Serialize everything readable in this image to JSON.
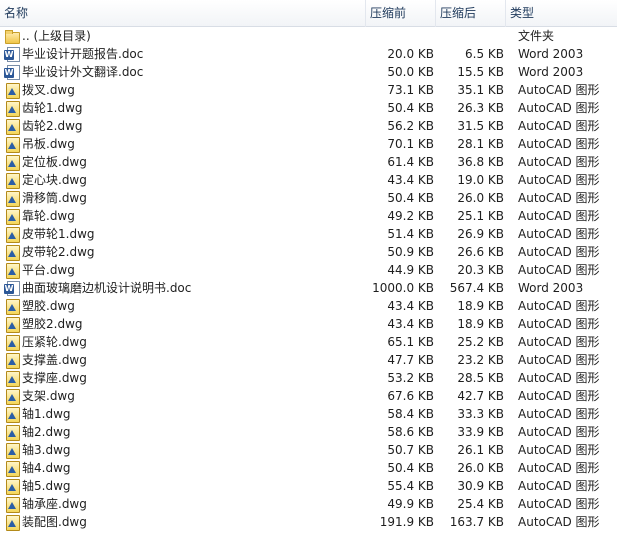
{
  "columns": {
    "name": "名称",
    "original_size": "压缩前",
    "compressed_size": "压缩后",
    "type": "类型"
  },
  "files": [
    {
      "icon": "folder-icon",
      "name": ".. (上级目录)",
      "original": "",
      "compressed": "",
      "type": "文件夹"
    },
    {
      "icon": "word-doc-icon",
      "name": "毕业设计开题报告.doc",
      "original": "20.0 KB",
      "compressed": "6.5 KB",
      "type": "Word 2003"
    },
    {
      "icon": "word-doc-icon",
      "name": "毕业设计外文翻译.doc",
      "original": "50.0 KB",
      "compressed": "15.5 KB",
      "type": "Word 2003"
    },
    {
      "icon": "autocad-dwg-icon",
      "name": "拨叉.dwg",
      "original": "73.1 KB",
      "compressed": "35.1 KB",
      "type": "AutoCAD 图形"
    },
    {
      "icon": "autocad-dwg-icon",
      "name": "齿轮1.dwg",
      "original": "50.4 KB",
      "compressed": "26.3 KB",
      "type": "AutoCAD 图形"
    },
    {
      "icon": "autocad-dwg-icon",
      "name": "齿轮2.dwg",
      "original": "56.2 KB",
      "compressed": "31.5 KB",
      "type": "AutoCAD 图形"
    },
    {
      "icon": "autocad-dwg-icon",
      "name": "吊板.dwg",
      "original": "70.1 KB",
      "compressed": "28.1 KB",
      "type": "AutoCAD 图形"
    },
    {
      "icon": "autocad-dwg-icon",
      "name": "定位板.dwg",
      "original": "61.4 KB",
      "compressed": "36.8 KB",
      "type": "AutoCAD 图形"
    },
    {
      "icon": "autocad-dwg-icon",
      "name": "定心块.dwg",
      "original": "43.4 KB",
      "compressed": "19.0 KB",
      "type": "AutoCAD 图形"
    },
    {
      "icon": "autocad-dwg-icon",
      "name": "滑移筒.dwg",
      "original": "50.4 KB",
      "compressed": "26.0 KB",
      "type": "AutoCAD 图形"
    },
    {
      "icon": "autocad-dwg-icon",
      "name": "靠轮.dwg",
      "original": "49.2 KB",
      "compressed": "25.1 KB",
      "type": "AutoCAD 图形"
    },
    {
      "icon": "autocad-dwg-icon",
      "name": "皮带轮1.dwg",
      "original": "51.4 KB",
      "compressed": "26.9 KB",
      "type": "AutoCAD 图形"
    },
    {
      "icon": "autocad-dwg-icon",
      "name": "皮带轮2.dwg",
      "original": "50.9 KB",
      "compressed": "26.6 KB",
      "type": "AutoCAD 图形"
    },
    {
      "icon": "autocad-dwg-icon",
      "name": "平台.dwg",
      "original": "44.9 KB",
      "compressed": "20.3 KB",
      "type": "AutoCAD 图形"
    },
    {
      "icon": "word-doc-icon",
      "name": "曲面玻璃磨边机设计说明书.doc",
      "original": "1000.0 KB",
      "compressed": "567.4 KB",
      "type": "Word 2003"
    },
    {
      "icon": "autocad-dwg-icon",
      "name": "塑胶.dwg",
      "original": "43.4 KB",
      "compressed": "18.9 KB",
      "type": "AutoCAD 图形"
    },
    {
      "icon": "autocad-dwg-icon",
      "name": "塑胶2.dwg",
      "original": "43.4 KB",
      "compressed": "18.9 KB",
      "type": "AutoCAD 图形"
    },
    {
      "icon": "autocad-dwg-icon",
      "name": "压紧轮.dwg",
      "original": "65.1 KB",
      "compressed": "25.2 KB",
      "type": "AutoCAD 图形"
    },
    {
      "icon": "autocad-dwg-icon",
      "name": "支撑盖.dwg",
      "original": "47.7 KB",
      "compressed": "23.2 KB",
      "type": "AutoCAD 图形"
    },
    {
      "icon": "autocad-dwg-icon",
      "name": "支撑座.dwg",
      "original": "53.2 KB",
      "compressed": "28.5 KB",
      "type": "AutoCAD 图形"
    },
    {
      "icon": "autocad-dwg-icon",
      "name": "支架.dwg",
      "original": "67.6 KB",
      "compressed": "42.7 KB",
      "type": "AutoCAD 图形"
    },
    {
      "icon": "autocad-dwg-icon",
      "name": "轴1.dwg",
      "original": "58.4 KB",
      "compressed": "33.3 KB",
      "type": "AutoCAD 图形"
    },
    {
      "icon": "autocad-dwg-icon",
      "name": "轴2.dwg",
      "original": "58.6 KB",
      "compressed": "33.9 KB",
      "type": "AutoCAD 图形"
    },
    {
      "icon": "autocad-dwg-icon",
      "name": "轴3.dwg",
      "original": "50.7 KB",
      "compressed": "26.1 KB",
      "type": "AutoCAD 图形"
    },
    {
      "icon": "autocad-dwg-icon",
      "name": "轴4.dwg",
      "original": "50.4 KB",
      "compressed": "26.0 KB",
      "type": "AutoCAD 图形"
    },
    {
      "icon": "autocad-dwg-icon",
      "name": "轴5.dwg",
      "original": "55.4 KB",
      "compressed": "30.9 KB",
      "type": "AutoCAD 图形"
    },
    {
      "icon": "autocad-dwg-icon",
      "name": "轴承座.dwg",
      "original": "49.9 KB",
      "compressed": "25.4 KB",
      "type": "AutoCAD 图形"
    },
    {
      "icon": "autocad-dwg-icon",
      "name": "装配图.dwg",
      "original": "191.9 KB",
      "compressed": "163.7 KB",
      "type": "AutoCAD 图形"
    }
  ]
}
